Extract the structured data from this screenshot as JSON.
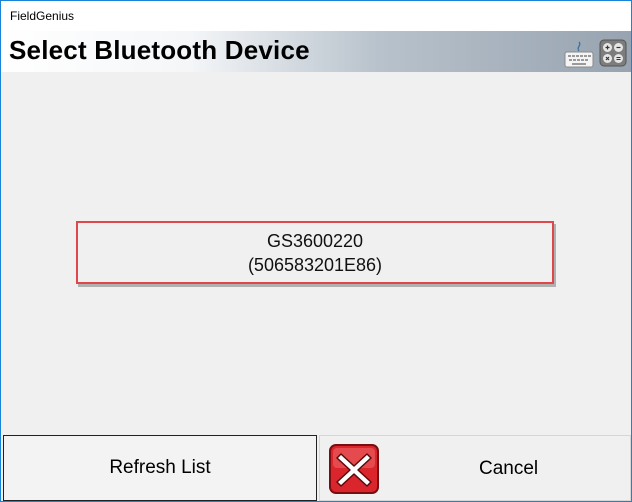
{
  "window": {
    "title": "FieldGenius"
  },
  "header": {
    "title": "Select Bluetooth Device",
    "icons": [
      "keyboard-icon",
      "calculator-icon"
    ]
  },
  "devices": [
    {
      "name": "GS3600220",
      "address": "(506583201E86)"
    }
  ],
  "buttons": {
    "refresh_label": "Refresh List",
    "cancel_label": "Cancel"
  },
  "colors": {
    "selection_border": "#e0474c",
    "cancel_icon_red": "#d9252b",
    "window_border": "#1883d7"
  }
}
